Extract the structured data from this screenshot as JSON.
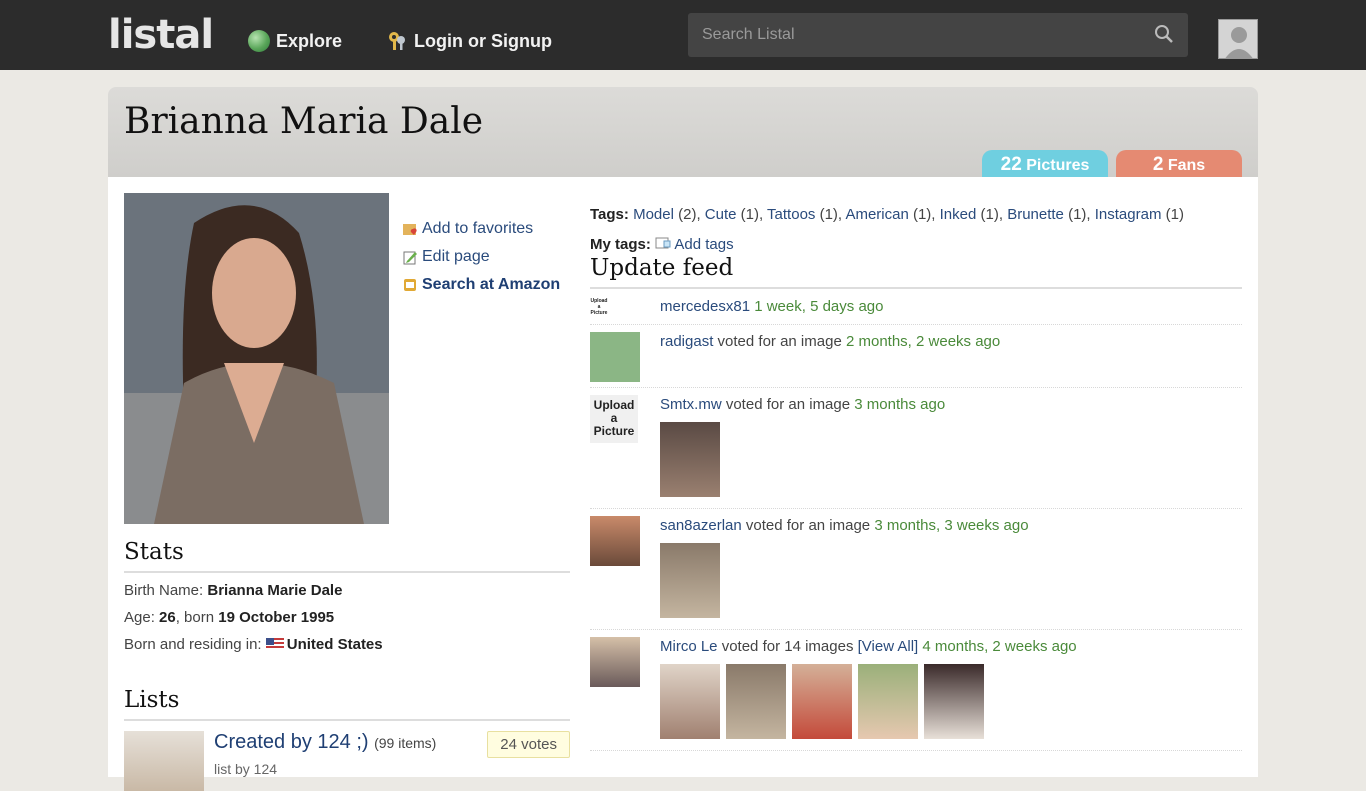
{
  "topbar": {
    "logo": "listal",
    "explore": "Explore",
    "login": "Login or Signup",
    "search_placeholder": "Search Listal"
  },
  "header": {
    "title": "Brianna Maria Dale",
    "pictures_count": "22",
    "pictures_label": "Pictures",
    "fans_count": "2",
    "fans_label": "Fans"
  },
  "actions": {
    "favorites": "Add to favorites",
    "edit": "Edit page",
    "amazon": "Search at Amazon"
  },
  "stats": {
    "heading": "Stats",
    "birth_name_label": "Birth Name:",
    "birth_name": "Brianna Marie Dale",
    "age_label": "Age:",
    "age": "26",
    "born_label": ", born",
    "born": "19 October 1995",
    "residing_label": "Born and residing in:",
    "country": "United States"
  },
  "lists": {
    "heading": "Lists",
    "items": [
      {
        "title": "Created by 124 ;)",
        "count": "(99 items)",
        "sub": "list by 124",
        "votes": "24 votes"
      }
    ]
  },
  "tags": {
    "label": "Tags:",
    "items": [
      {
        "name": "Model",
        "count": " (2)"
      },
      {
        "name": "Cute",
        "count": " (1)"
      },
      {
        "name": "Tattoos",
        "count": " (1)"
      },
      {
        "name": "American",
        "count": " (1)"
      },
      {
        "name": "Inked",
        "count": " (1)"
      },
      {
        "name": "Brunette",
        "count": " (1)"
      },
      {
        "name": "Instagram",
        "count": " (1)"
      }
    ],
    "my_tags_label": "My tags:",
    "add_tags": "Add tags"
  },
  "feed": {
    "heading": "Update feed",
    "items": [
      {
        "user": "mercedesx81",
        "action": "",
        "time": "1 week, 5 days ago"
      },
      {
        "user": "radigast",
        "action": "voted for an image",
        "time": "2 months, 2 weeks ago"
      },
      {
        "user": "Smtx.mw",
        "action": "voted for an image",
        "time": "3 months ago"
      },
      {
        "user": "san8azerlan",
        "action": "voted for an image",
        "time": "3 months, 3 weeks ago"
      },
      {
        "user": "Mirco Le",
        "action": "voted for 14 images",
        "viewall": "[View All]",
        "time": "4 months, 2 weeks ago"
      }
    ],
    "upload_placeholder_text": "Upload a Picture"
  }
}
